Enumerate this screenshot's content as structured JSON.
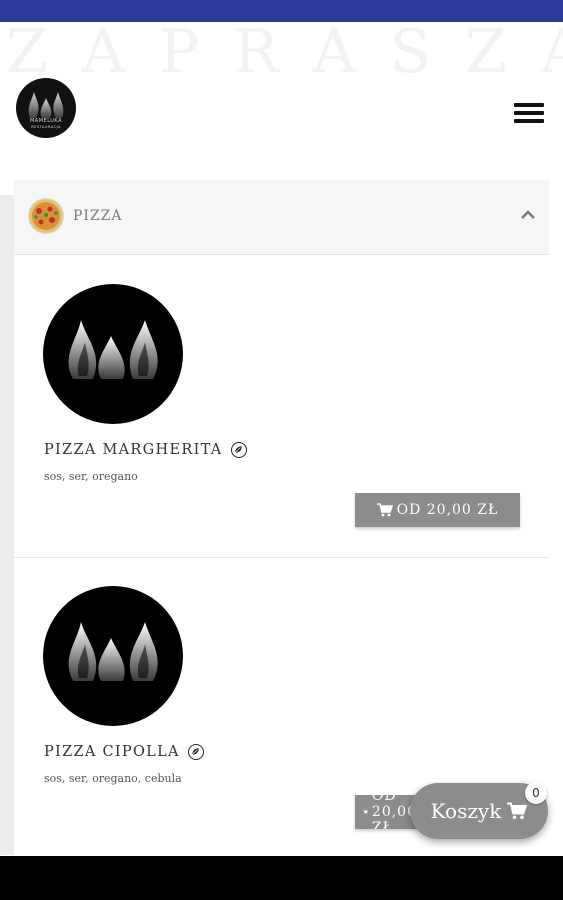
{
  "header": {
    "watermark": "ZAPRASZAMY",
    "logo_name": "MAMELUKA",
    "logo_sub": "RESTAURACJA"
  },
  "category": {
    "title": "PIZZA"
  },
  "products": [
    {
      "name": "PIZZA MARGHERITA",
      "description": "sos, ser, oregano",
      "price_label": "OD 20,00 ZŁ"
    },
    {
      "name": "PIZZA CIPOLLA",
      "description": "sos, ser, oregano, cebula",
      "price_label": "OD 20,00 ZŁ"
    }
  ],
  "cart": {
    "label": "Koszyk",
    "count": "0"
  },
  "colors": {
    "status_bar": "#2f3c9a",
    "button_gray": "#8c8c8c"
  },
  "icons": [
    "hamburger-menu-icon",
    "chevron-up-icon",
    "vegetarian-leaf-icon",
    "shopping-cart-icon"
  ]
}
